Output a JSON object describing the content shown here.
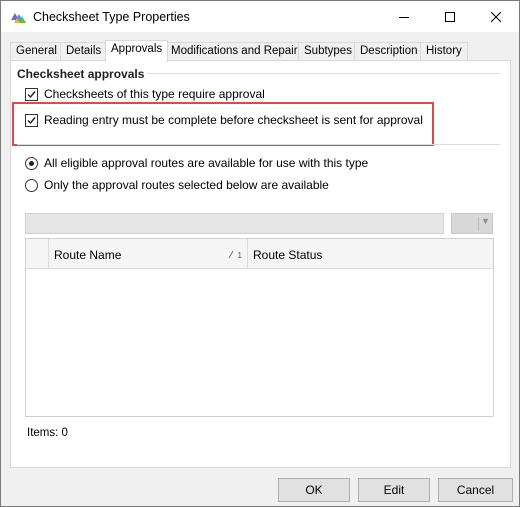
{
  "window": {
    "title": "Checksheet Type Properties",
    "controls": {
      "minimize": "minimize",
      "maximize": "maximize",
      "close": "close"
    }
  },
  "tabs": [
    {
      "label": "General",
      "active": false
    },
    {
      "label": "Details",
      "active": false
    },
    {
      "label": "Approvals",
      "active": true
    },
    {
      "label": "Modifications and Repairs",
      "active": false
    },
    {
      "label": "Subtypes",
      "active": false
    },
    {
      "label": "Description",
      "active": false
    },
    {
      "label": "History",
      "active": false
    }
  ],
  "approvals": {
    "group_title": "Checksheet approvals",
    "require_approval": {
      "label": "Checksheets of this type require approval",
      "checked": true
    },
    "reading_complete": {
      "label": "Reading entry must be complete before checksheet is sent for approval",
      "checked": true
    },
    "route_options": [
      {
        "label": "All eligible approval routes are available for use with this type",
        "selected": true
      },
      {
        "label": "Only the approval routes selected below are available",
        "selected": false
      }
    ]
  },
  "grid": {
    "columns": [
      {
        "label": "Route Name",
        "sort": "1"
      },
      {
        "label": "Route Status"
      }
    ],
    "rows": [],
    "items_label": "Items: 0"
  },
  "buttons": {
    "ok": "OK",
    "edit": "Edit",
    "cancel": "Cancel"
  },
  "colors": {
    "highlight": "#e0474c",
    "accent": "#0078d7"
  }
}
